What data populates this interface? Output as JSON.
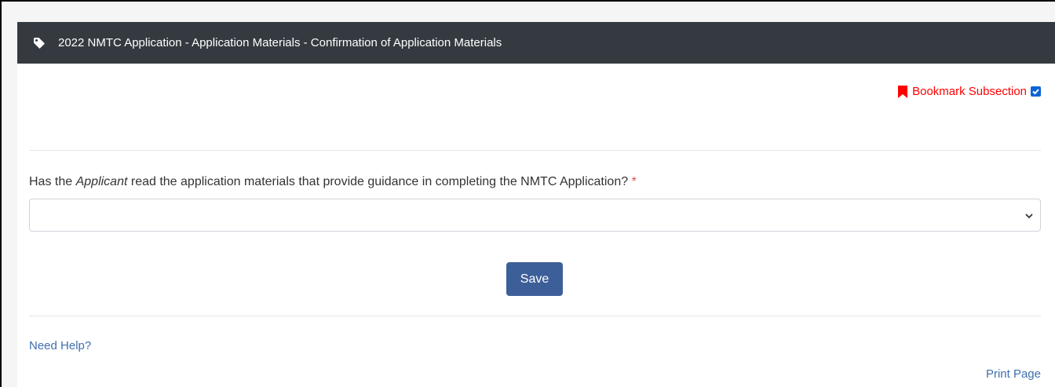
{
  "header": {
    "title": "2022 NMTC Application - Application Materials - Confirmation of Application Materials",
    "icon": "tag-icon"
  },
  "bookmark": {
    "label": "Bookmark Subsection",
    "checked": true,
    "icon": "bookmark-icon",
    "color": "#ff0000"
  },
  "question": {
    "prefix": "Has the ",
    "emphasis": "Applicant",
    "suffix": " read the application materials that provide guidance in completing the NMTC Application?",
    "required_marker": "*"
  },
  "select": {
    "value": ""
  },
  "save_label": "Save",
  "footer": {
    "help_link": "Need Help?",
    "print_link": "Print Page"
  },
  "colors": {
    "header_bg": "#343a40",
    "button_bg": "#3d5f99",
    "link": "#3f6fb0"
  }
}
